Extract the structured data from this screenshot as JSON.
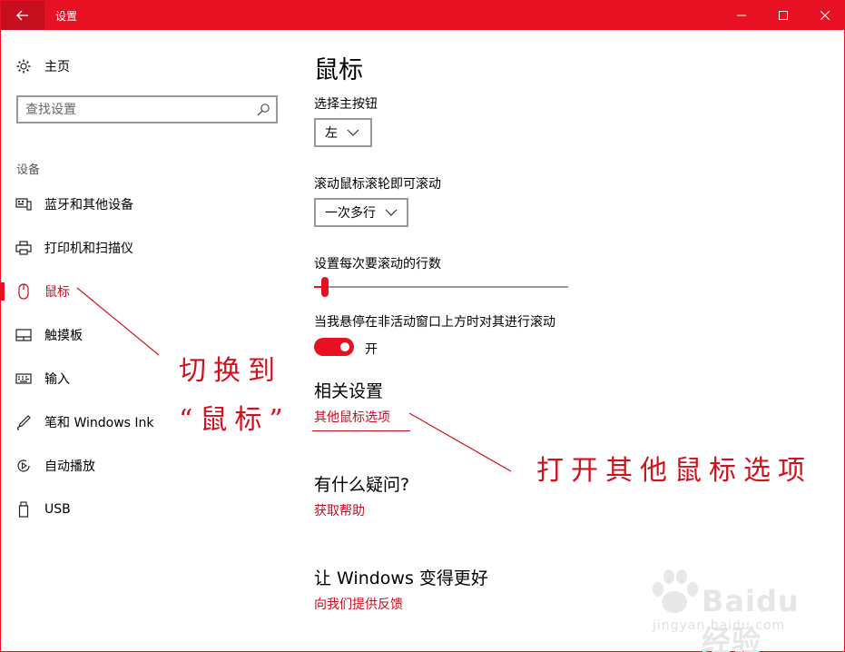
{
  "window": {
    "title": "设置"
  },
  "sidebar": {
    "home_label": "主页",
    "search_placeholder": "查找设置",
    "section_label": "设备",
    "items": [
      {
        "label": "蓝牙和其他设备",
        "icon": "devices-icon"
      },
      {
        "label": "打印机和扫描仪",
        "icon": "printer-icon"
      },
      {
        "label": "鼠标",
        "icon": "mouse-icon",
        "active": true
      },
      {
        "label": "触摸板",
        "icon": "touchpad-icon"
      },
      {
        "label": "输入",
        "icon": "keyboard-icon"
      },
      {
        "label": "笔和 Windows Ink",
        "icon": "pen-icon"
      },
      {
        "label": "自动播放",
        "icon": "autoplay-icon"
      },
      {
        "label": "USB",
        "icon": "usb-icon"
      }
    ]
  },
  "main": {
    "title": "鼠标",
    "primary_button_label": "选择主按钮",
    "primary_button_value": "左",
    "scroll_label": "滚动鼠标滚轮即可滚动",
    "scroll_value": "一次多行",
    "lines_label": "设置每次要滚动的行数",
    "lines_slider_level": 0.03,
    "inactive_scroll_label": "当我悬停在非活动窗口上方时对其进行滚动",
    "inactive_scroll_state": "开",
    "related_heading": "相关设置",
    "related_link": "其他鼠标选项",
    "question_heading": "有什么疑问?",
    "help_link": "获取帮助",
    "improve_heading": "让 Windows 变得更好",
    "feedback_link": "向我们提供反馈"
  },
  "annotations": {
    "switch_line1": "切换到",
    "switch_line2": "“鼠标”",
    "open_options": "打开其他鼠标选项"
  },
  "watermark": {
    "brand": "Baidu经验",
    "url": "jingyan.baidu.com"
  },
  "colors": {
    "accent": "#e81123",
    "accent_dark": "#c50f1f",
    "annotation": "#d0121e"
  }
}
